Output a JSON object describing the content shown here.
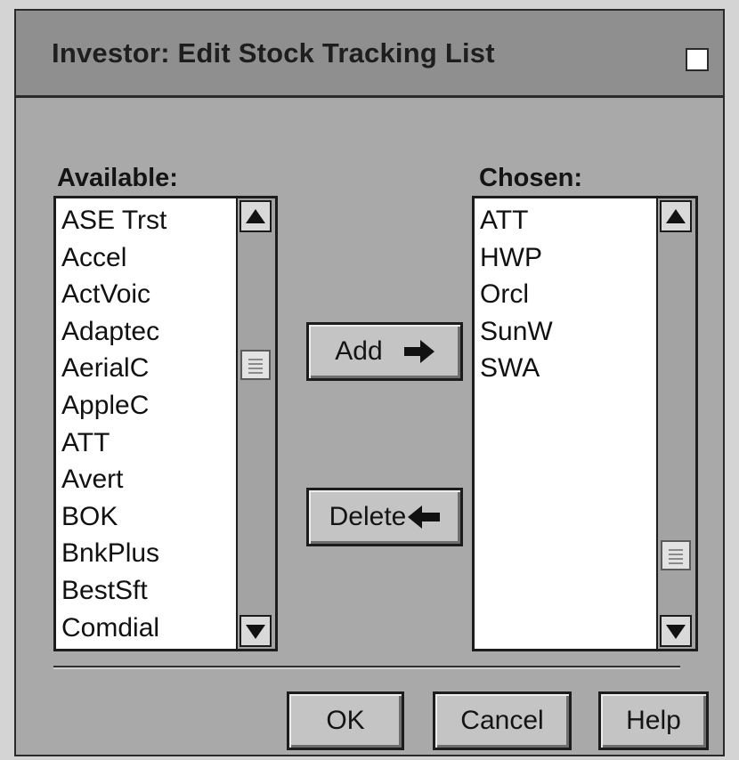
{
  "window": {
    "title": "Investor: Edit Stock Tracking List"
  },
  "available": {
    "label": "Available:",
    "items": [
      "ASE Trst",
      "Accel",
      "ActVoic",
      "Adaptec",
      "AerialC",
      "AppleC",
      "ATT",
      "Avert",
      "BOK",
      "BnkPlus",
      "BestSft",
      "Comdial"
    ]
  },
  "chosen": {
    "label": "Chosen:",
    "items": [
      "ATT",
      "HWP",
      "Orcl",
      "SunW",
      "SWA"
    ]
  },
  "buttons": {
    "add": "Add",
    "delete": "Delete",
    "ok": "OK",
    "cancel": "Cancel",
    "help": "Help"
  },
  "icons": {
    "add": "arrow-right-icon",
    "delete": "arrow-left-icon",
    "scroll_up": "triangle-up-icon",
    "scroll_down": "triangle-down-icon",
    "window_box": "square-icon"
  },
  "colors": {
    "dialog_bg": "#a9a9a9",
    "titlebar_bg": "#8f8f8f",
    "list_bg": "#ffffff",
    "button_bg": "#c4c4c4"
  }
}
